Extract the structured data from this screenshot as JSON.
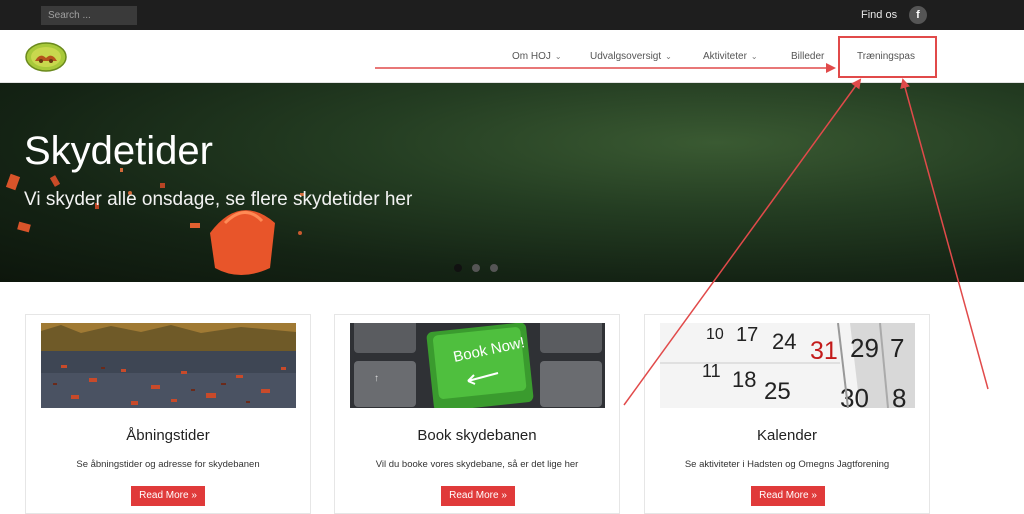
{
  "topbar": {
    "search_placeholder": "Search ...",
    "find_us": "Find os",
    "facebook_glyph": "f"
  },
  "nav": {
    "items": [
      {
        "label": "Om HOJ",
        "has_dropdown": true
      },
      {
        "label": "Udvalgsoversigt",
        "has_dropdown": true
      },
      {
        "label": "Aktiviteter",
        "has_dropdown": true
      },
      {
        "label": "Billeder",
        "has_dropdown": false
      },
      {
        "label": "Træningspas",
        "has_dropdown": false
      }
    ],
    "chevron": "⌄"
  },
  "hero": {
    "title": "Skydetider",
    "subtitle": "Vi skyder alle onsdage, se flere skydetider her",
    "slides_total": 3,
    "active_slide": 1
  },
  "cards": [
    {
      "title": "Åbningstider",
      "text": "Se åbningstider og adresse for skydebanen",
      "button": "Read More »",
      "image": "clay-shards-image"
    },
    {
      "title": "Book skydebanen",
      "text": "Vil du booke vores skydebane, så er det lige her",
      "button": "Read More »",
      "image": "keyboard-book-now-image",
      "image_key_label": "Book Now!"
    },
    {
      "title": "Kalender",
      "text": "Se aktiviteter i Hadsten og Omegns Jagtforening",
      "button": "Read More »",
      "image": "calendar-image",
      "calendar_numbers": [
        "10",
        "17",
        "24",
        "31",
        "29",
        "7",
        "11",
        "18",
        "25",
        "30",
        "8"
      ]
    }
  ],
  "colors": {
    "topbar": "#1e1e1e",
    "accent_red": "#e03a3a",
    "annotation_red": "#e14a4a"
  }
}
